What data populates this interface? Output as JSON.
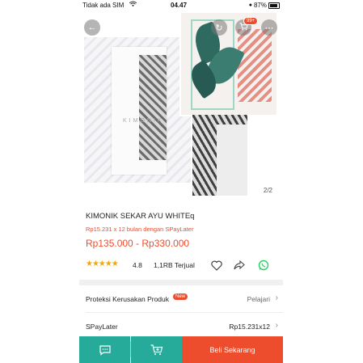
{
  "status_bar": {
    "carrier": "Tidak ada SIM",
    "time": "04.47",
    "battery": "87%",
    "battery_level": 0.87
  },
  "gallery": {
    "brand_watermark": "KIMONIK",
    "cart_badge": "99+",
    "page_indicator": "2/2"
  },
  "product": {
    "title": "KIMONIK SEKAR AYU WHITEq",
    "installment": "Rp15.231 x 12 bulan dengan SPayLater",
    "price": "Rp135.000 - Rp330.000",
    "rating": "4.8",
    "stars": 4.8,
    "sold": "1,1RB Terjual"
  },
  "rows": [
    {
      "label": "Proteksi Kerusakan Produk",
      "badge": "New",
      "value": "Pelajari"
    },
    {
      "label": "SPayLater",
      "value": "Rp15.231x12"
    }
  ],
  "bottom_bar": {
    "buy_label": "Beli Sekarang"
  },
  "colors": {
    "accent": "#ee4d2d",
    "teal": "#26aa99",
    "star": "#f6a700"
  },
  "icons": [
    "back-arrow-icon",
    "share-icon",
    "cart-icon",
    "more-icon",
    "heart-icon",
    "forward-icon",
    "whatsapp-icon",
    "chat-icon",
    "add-to-cart-icon"
  ]
}
